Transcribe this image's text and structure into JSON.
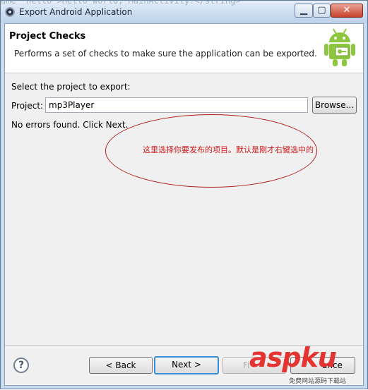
{
  "window": {
    "title": "Export Android Application",
    "background_text": "ame  hello\">Hello world, MainActivity!</string>",
    "controls": {
      "minimize": "▁",
      "maximize": "▢",
      "close": "✕"
    }
  },
  "header": {
    "title": "Project Checks",
    "description": "Performs a set of checks to make sure the application can be exported.",
    "icon": "android-robot-icon"
  },
  "form": {
    "select_label": "Select the project to export:",
    "project_label": "Project:",
    "project_value": "mp3Player",
    "browse_label": "Browse...",
    "status": "No errors found. Click Next."
  },
  "annotation": {
    "text": "这里选择你要发布的项目。默认是刚才右键选中的",
    "color": "#d01818"
  },
  "footer": {
    "help_label": "?",
    "back_label": "< Back",
    "next_label": "Next >",
    "finish_label": "Fi",
    "cancel_label": "ance"
  },
  "watermark": {
    "logo": "aspku",
    "subtitle": "免费网站源码下载站"
  }
}
